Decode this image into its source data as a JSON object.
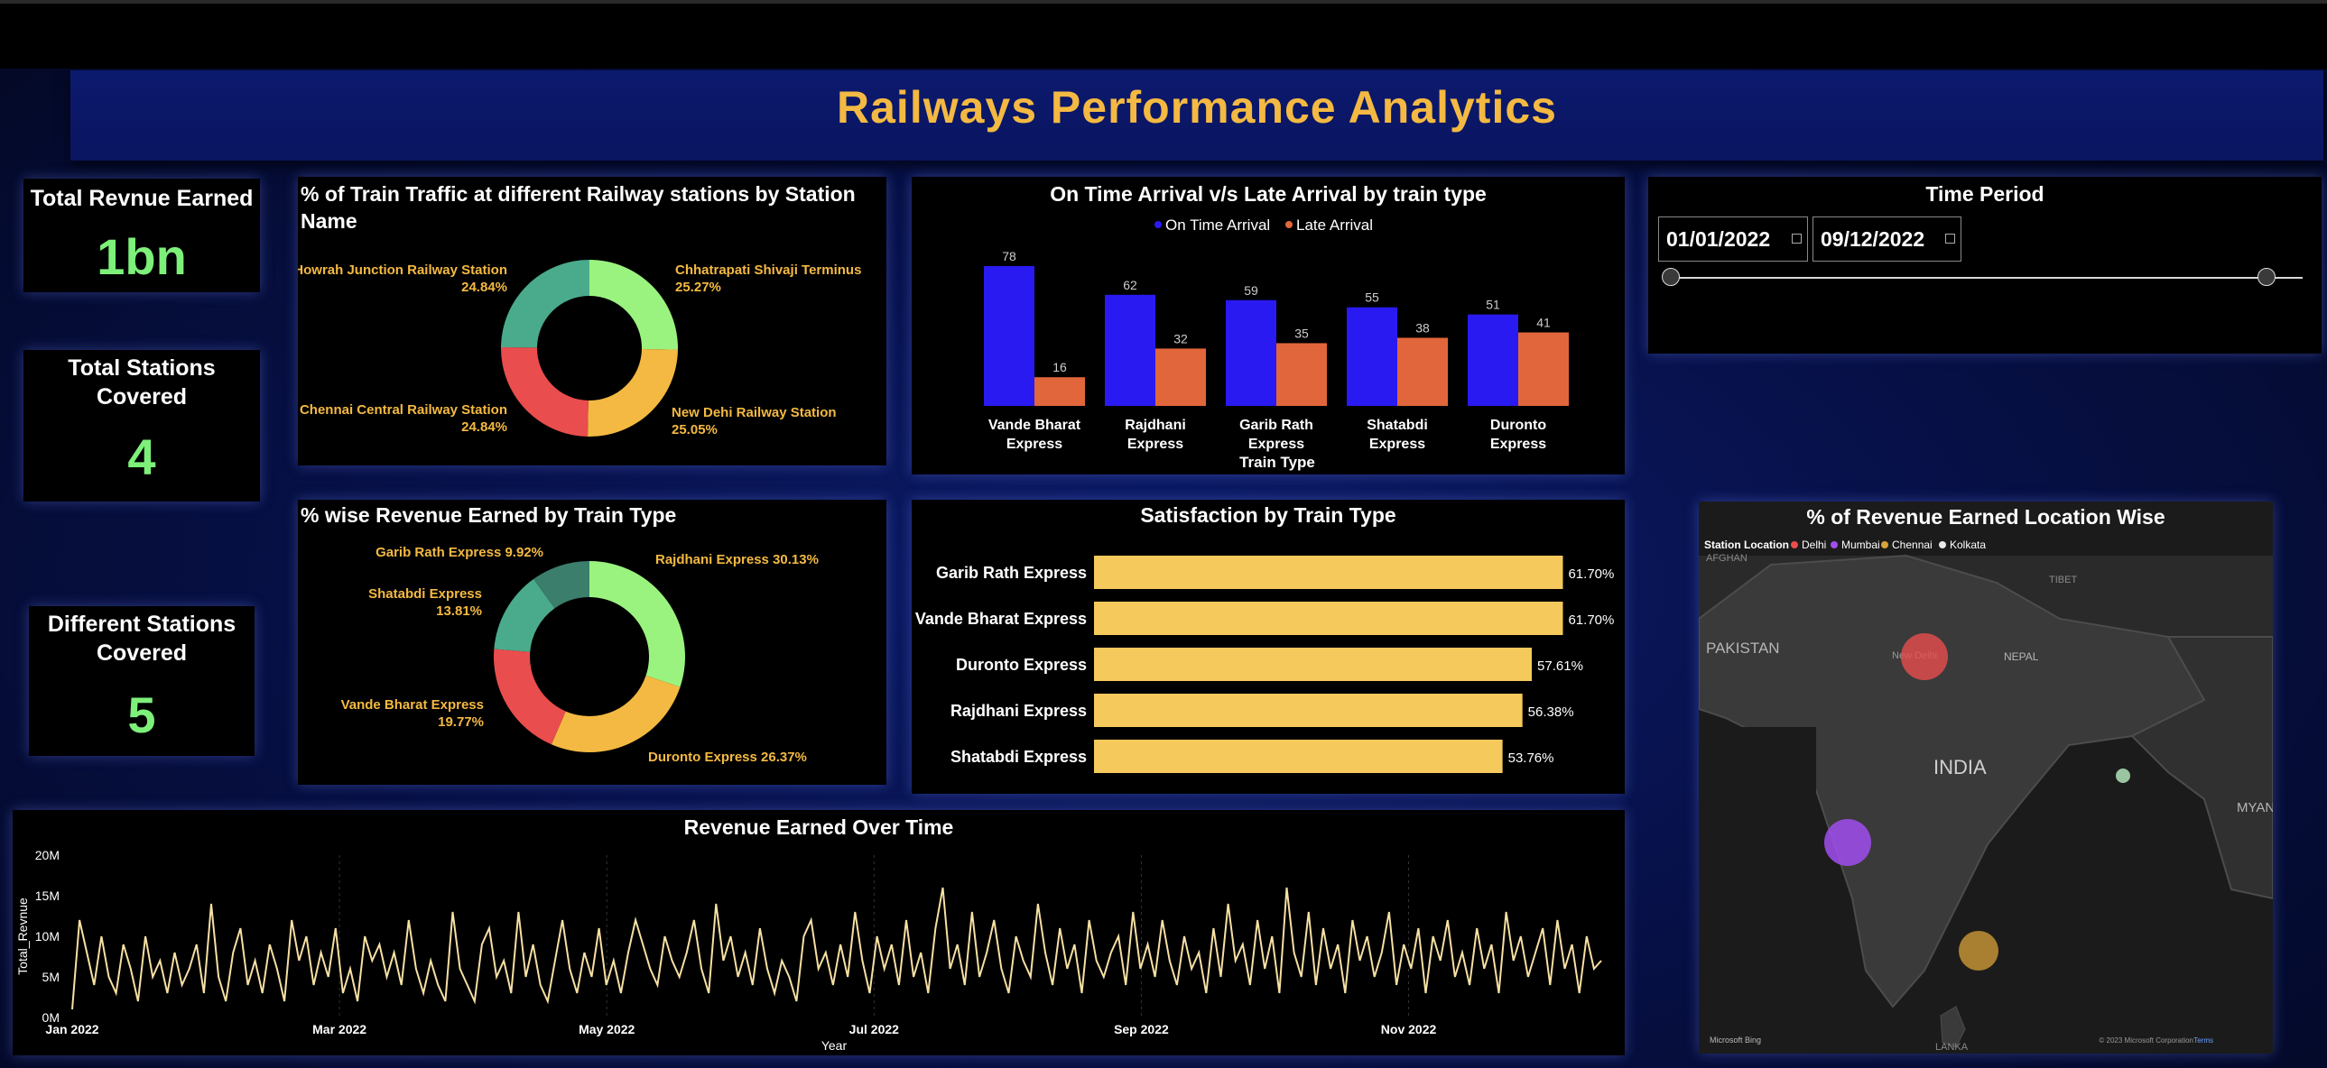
{
  "title": "Railways Performance Analytics",
  "kpis": {
    "revenue": {
      "label": "Total Revnue Earned",
      "value": "1bn"
    },
    "stations_covered": {
      "label_line1": "Total Stations",
      "label_line2": "Covered",
      "value": "4"
    },
    "different_stations": {
      "label_line1": "Different Stations",
      "label_line2": "Covered",
      "value": "5"
    }
  },
  "time_period": {
    "title": "Time Period",
    "start": "01/01/2022",
    "end": "09/12/2022",
    "start_fraction": 0.0,
    "end_fraction": 1.0
  },
  "traffic_donut": {
    "title_line1": "% of Train Traffic at different Railway stations by Station",
    "title_line2": "Name",
    "slices": [
      {
        "name": "Chhatrapati Shivaji Terminus",
        "pct_label": "25.27%",
        "value": 25.27,
        "color": "#9bf37f"
      },
      {
        "name": "New Dehi Railway Station",
        "pct_label": "25.05%",
        "value": 25.05,
        "color": "#f4b942"
      },
      {
        "name": "Chennai Central Railway Station",
        "pct_label": "24.84%",
        "value": 24.84,
        "color": "#ea4d4d"
      },
      {
        "name": "Howrah Junction Railway Station",
        "pct_label": "24.84%",
        "value": 24.84,
        "color": "#4aab8c"
      }
    ]
  },
  "revenue_donut": {
    "title": "% wise Revenue Earned by Train Type",
    "slices": [
      {
        "label": "Rajdhani Express 30.13%",
        "value": 30.13,
        "color": "#9bf37f"
      },
      {
        "label": "Duronto Express 26.37%",
        "value": 26.37,
        "color": "#f4b942"
      },
      {
        "label_line1": "Vande Bharat Express",
        "label_line2": "19.77%",
        "value": 19.77,
        "color": "#ea4d4d"
      },
      {
        "label_line1": "Shatabdi Express",
        "label_line2": "13.81%",
        "value": 13.81,
        "color": "#4aab8c"
      },
      {
        "label": "Garib Rath Express 9.92%",
        "value": 9.92,
        "color": "#3b7e6c"
      }
    ]
  },
  "arrival_chart": {
    "title": "On Time Arrival v/s Late Arrival by train type",
    "legend": [
      "On Time Arrival",
      "Late Arrival"
    ],
    "xlabel": "Train Type",
    "colors": {
      "on_time": "#2a1af2",
      "late": "#e2663b"
    }
  },
  "satisfaction": {
    "title": "Satisfaction by Train Type",
    "color": "#f5c95c"
  },
  "location_map": {
    "title": "% of Revenue Earned Location Wise",
    "legend_title": "Station Location",
    "legend": [
      {
        "name": "Delhi",
        "color": "#ea4d4d"
      },
      {
        "name": "Mumbai",
        "color": "#a14df0"
      },
      {
        "name": "Chennai",
        "color": "#d9a23a"
      },
      {
        "name": "Kolkata",
        "color": "#e8e8e8"
      }
    ],
    "labels": {
      "country": "INDIA",
      "west": "PAKISTAN",
      "nepal": "NEPAL",
      "east": "MYANI",
      "tibet": "TIBET",
      "delhi": "New Delhi",
      "afghan": "AFGHAN",
      "lanka": "LANKA"
    },
    "footer_left": "Microsoft Bing",
    "footer_right": "© 2023 Microsoft Corporation",
    "footer_terms": "Terms"
  },
  "chart_data": [
    {
      "type": "bar",
      "title": "On Time Arrival v/s Late Arrival by train type",
      "xlabel": "Train Type",
      "categories": [
        "Vande Bharat Express",
        "Rajdhani Express",
        "Garib Rath Express",
        "Shatabdi Express",
        "Duronto Express"
      ],
      "category_lines": [
        [
          "Vande Bharat",
          "Express"
        ],
        [
          "Rajdhani",
          "Express"
        ],
        [
          "Garib Rath",
          "Express"
        ],
        [
          "Shatabdi",
          "Express"
        ],
        [
          "Duronto",
          "Express"
        ]
      ],
      "series": [
        {
          "name": "On Time Arrival",
          "values": [
            78,
            62,
            59,
            55,
            51
          ]
        },
        {
          "name": "Late Arrival",
          "values": [
            16,
            32,
            35,
            38,
            41
          ]
        }
      ],
      "ylim": [
        0,
        80
      ]
    },
    {
      "type": "bar",
      "orientation": "horizontal",
      "title": "Satisfaction by Train Type",
      "categories": [
        "Garib Rath Express",
        "Vande Bharat Express",
        "Duronto Express",
        "Rajdhani Express",
        "Shatabdi Express"
      ],
      "values": [
        61.7,
        61.7,
        57.61,
        56.38,
        53.76
      ],
      "value_labels": [
        "61.70%",
        "61.70%",
        "57.61%",
        "56.38%",
        "53.76%"
      ],
      "xlim": [
        0,
        62
      ]
    },
    {
      "type": "line",
      "title": "Revenue Earned Over Time",
      "xlabel": "Year",
      "ylabel": "Total_Revnue",
      "yticks": [
        "0M",
        "5M",
        "10M",
        "15M",
        "20M"
      ],
      "ylim": [
        0,
        20
      ],
      "xticks": [
        "Jan 2022",
        "Mar 2022",
        "May 2022",
        "Jul 2022",
        "Sep 2022",
        "Nov 2022"
      ],
      "color": "#f7e0a3",
      "values_millions": [
        1,
        12,
        8,
        4,
        10,
        5,
        3,
        9,
        6,
        2,
        10,
        5,
        7,
        3,
        8,
        4,
        6,
        9,
        3,
        14,
        5,
        2,
        8,
        11,
        4,
        7,
        3,
        9,
        6,
        2,
        12,
        7,
        10,
        4,
        8,
        5,
        11,
        3,
        6,
        2,
        10,
        7,
        9,
        5,
        8,
        4,
        12,
        6,
        3,
        7,
        4,
        2,
        13,
        6,
        4,
        2,
        9,
        11,
        5,
        7,
        3,
        13,
        5,
        9,
        4,
        2,
        7,
        12,
        6,
        3,
        8,
        5,
        11,
        4,
        7,
        3,
        8,
        12,
        9,
        6,
        4,
        10,
        7,
        5,
        8,
        12,
        6,
        3,
        14,
        7,
        10,
        5,
        8,
        4,
        11,
        6,
        3,
        7,
        5,
        2,
        10,
        12,
        6,
        8,
        4,
        9,
        5,
        13,
        7,
        3,
        10,
        6,
        9,
        4,
        12,
        5,
        8,
        3,
        11,
        16,
        6,
        9,
        4,
        13,
        5,
        8,
        12,
        6,
        3,
        10,
        7,
        5,
        14,
        8,
        4,
        11,
        6,
        9,
        3,
        12,
        7,
        5,
        8,
        10,
        4,
        13,
        6,
        9,
        5,
        12,
        7,
        4,
        10,
        6,
        8,
        3,
        11,
        5,
        14,
        7,
        9,
        4,
        12,
        6,
        10,
        3,
        16,
        8,
        5,
        13,
        4,
        11,
        6,
        9,
        3,
        12,
        7,
        10,
        5,
        8,
        13,
        4,
        9,
        6,
        11,
        3,
        10,
        7,
        12,
        5,
        8,
        4,
        11,
        6,
        9,
        3,
        13,
        7,
        10,
        5,
        8,
        11,
        4,
        12,
        6,
        9,
        3,
        10,
        6,
        7
      ]
    }
  ]
}
